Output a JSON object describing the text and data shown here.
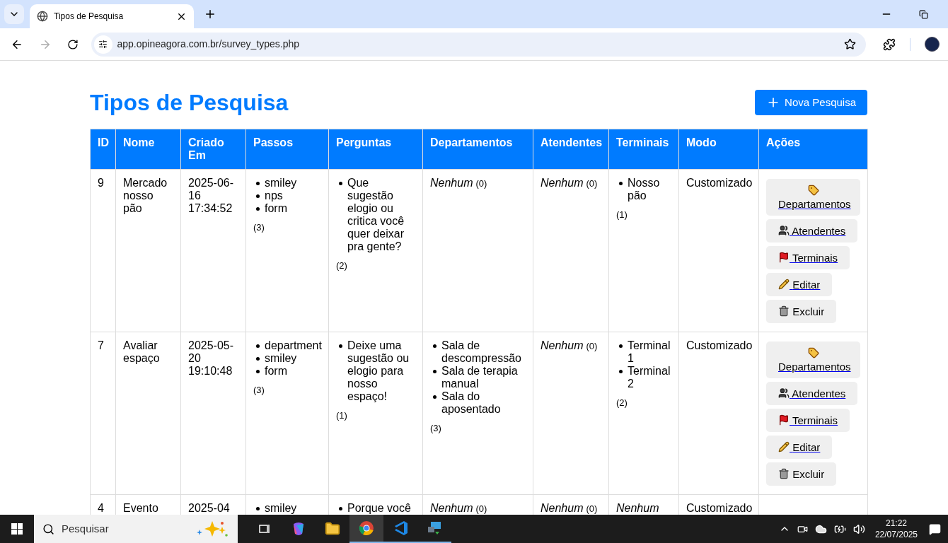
{
  "browser": {
    "tab_title": "Tipos de Pesquisa",
    "url": "app.opineagora.com.br/survey_types.php"
  },
  "page": {
    "title": "Tipos de Pesquisa",
    "new_button": "Nova Pesquisa"
  },
  "table": {
    "columns": [
      "ID",
      "Nome",
      "Criado Em",
      "Passos",
      "Perguntas",
      "Departamentos",
      "Atendentes",
      "Terminais",
      "Modo",
      "Ações"
    ],
    "rows": [
      {
        "id": "9",
        "name": "Mercado nosso pão",
        "created": "2025-06-16 17:34:52",
        "steps": {
          "kind": "list",
          "items": [
            "smiley",
            "nps",
            "form"
          ],
          "count": "(3)"
        },
        "questions": {
          "kind": "list",
          "items": [
            "Que sugestão elogio ou critica você quer deixar pra gente?"
          ],
          "count": "(2)"
        },
        "departments": {
          "kind": "none",
          "label": "Nenhum",
          "count": "(0)"
        },
        "attendants": {
          "kind": "none",
          "label": "Nenhum",
          "count": "(0)"
        },
        "terminals": {
          "kind": "list",
          "items": [
            "Nosso pão"
          ],
          "count": "(1)"
        },
        "mode": "Customizado",
        "actions": [
          {
            "kind": "departments",
            "label": "Departamentos"
          },
          {
            "kind": "attendants",
            "label": "Atendentes"
          },
          {
            "kind": "terminals",
            "label": "Terminais"
          },
          {
            "kind": "edit",
            "label": "Editar"
          },
          {
            "kind": "delete",
            "label": "Excluir"
          }
        ]
      },
      {
        "id": "7",
        "name": "Avaliar espaço",
        "created": "2025-05-20 19:10:48",
        "steps": {
          "kind": "list",
          "items": [
            "department",
            "smiley",
            "form"
          ],
          "count": "(3)"
        },
        "questions": {
          "kind": "list",
          "items": [
            "Deixe uma sugestão ou elogio para nosso espaço!"
          ],
          "count": "(1)"
        },
        "departments": {
          "kind": "list",
          "items": [
            "Sala de descompressão",
            "Sala de terapia manual",
            "Sala do aposentado"
          ],
          "count": "(3)"
        },
        "attendants": {
          "kind": "none",
          "label": "Nenhum",
          "count": "(0)"
        },
        "terminals": {
          "kind": "list",
          "items": [
            "Terminal 1",
            "Terminal 2"
          ],
          "count": "(2)"
        },
        "mode": "Customizado",
        "actions": [
          {
            "kind": "departments",
            "label": "Departamentos"
          },
          {
            "kind": "attendants",
            "label": "Atendentes"
          },
          {
            "kind": "terminals",
            "label": "Terminais"
          },
          {
            "kind": "edit",
            "label": "Editar"
          },
          {
            "kind": "delete",
            "label": "Excluir"
          }
        ]
      },
      {
        "id": "4",
        "name": "Evento",
        "created": "2025-04",
        "steps": {
          "kind": "list",
          "items": [
            "smiley"
          ]
        },
        "questions": {
          "kind": "list",
          "items": [
            "Porque você"
          ]
        },
        "departments": {
          "kind": "none",
          "label": "Nenhum",
          "count": "(0)"
        },
        "attendants": {
          "kind": "none",
          "label": "Nenhum",
          "count": "(0)"
        },
        "terminals": {
          "kind": "none",
          "label": "Nenhum"
        },
        "mode": "Customizado"
      }
    ]
  },
  "taskbar": {
    "search_placeholder": "Pesquisar",
    "time": "21:22",
    "date": "22/07/2025"
  }
}
